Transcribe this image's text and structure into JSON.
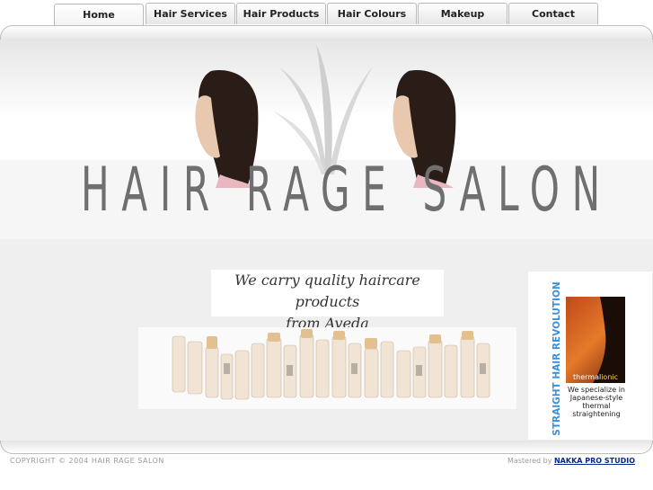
{
  "nav": {
    "tabs": [
      {
        "label": "Home"
      },
      {
        "label": "Hair Services"
      },
      {
        "label": "Hair Products"
      },
      {
        "label": "Hair Colours"
      },
      {
        "label": "Makeup"
      },
      {
        "label": "Contact"
      }
    ],
    "active": "Home"
  },
  "banner": {
    "title": "HAIR RAGE SALON"
  },
  "main": {
    "tagline_line1": "We carry quality haircare products",
    "tagline_line2": "from Aveda"
  },
  "ad": {
    "vertical_text": "STRAIGHT HAIR REVOLUTION",
    "brand_prefix": "thermal",
    "brand_suffix": "ionic",
    "caption": "We specialize in Japanese-style thermal straightening"
  },
  "footer": {
    "copyright": "COPYRIGHT © 2004 HAIR RAGE SALON",
    "mastered_prefix": "Mastered by",
    "studio": "NAKKA PRO STUDIO"
  },
  "colors": {
    "title_gray": "#6f6f6f",
    "link_blue": "#0a2a8a",
    "ad_blue": "#3b8fd6"
  }
}
